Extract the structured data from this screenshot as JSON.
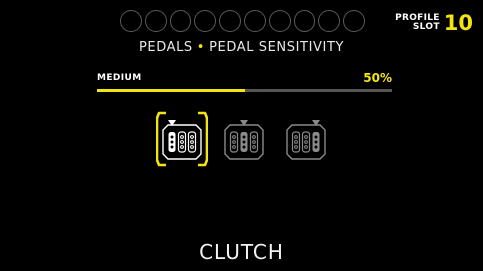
{
  "slots": {
    "count": 10
  },
  "profile": {
    "label_line1": "PROFILE",
    "label_line2": "SLOT",
    "number": "10"
  },
  "breadcrumb": {
    "section": "PEDALS",
    "separator": "•",
    "page": "PEDAL SENSITIVITY"
  },
  "setting": {
    "label": "MEDIUM",
    "value_text": "50%",
    "value": 50,
    "max": 100
  },
  "pedals": [
    {
      "name": "clutch",
      "selected": true
    },
    {
      "name": "brake",
      "selected": false
    },
    {
      "name": "throttle",
      "selected": false
    }
  ],
  "colors": {
    "accent": "#f3e512",
    "inactive": "#5a5a5a",
    "background": "#000000"
  },
  "footer": {
    "title": "CLUTCH"
  }
}
